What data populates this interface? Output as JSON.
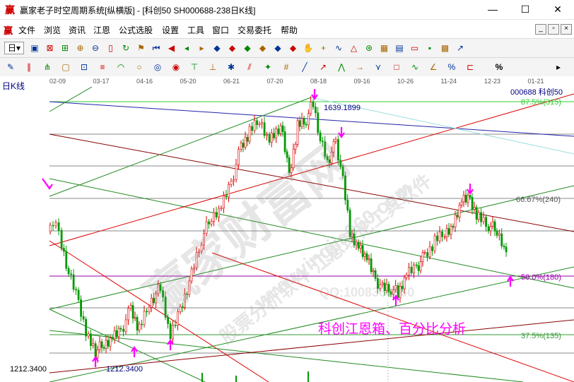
{
  "window": {
    "app_icon": "赢",
    "title": "赢家老子时空周期系统[纵横版] - [科创50   SH000688-238日K线]",
    "minimize": "—",
    "maximize": "☐",
    "close": "✕"
  },
  "menu": {
    "icon": "赢",
    "items": [
      "文件",
      "浏览",
      "资讯",
      "江恩",
      "公式选股",
      "设置",
      "工具",
      "窗口",
      "交易委托",
      "帮助"
    ],
    "mdi_buttons": [
      "_",
      "▫",
      "×"
    ]
  },
  "toolbar1": {
    "period_selector": "日",
    "icons": [
      "select-icon",
      "lock-icon",
      "data-icon",
      "zoom-in-icon",
      "zoom-out-icon",
      "cursor-icon",
      "refresh-icon",
      "flag-icon",
      "first-icon",
      "prev-icon",
      "left-icon",
      "right-icon",
      "diamond-icon",
      "diamond-icon",
      "diamond-icon",
      "diamond-icon",
      "diamond-icon",
      "diamond-icon",
      "hand-icon",
      "crosshair-icon",
      "wave-icon",
      "triangle-icon",
      "gann-icon",
      "calendar-icon",
      "calc-icon",
      "screen-icon",
      "save-icon",
      "print-icon",
      "trend-icon"
    ]
  },
  "toolbar2": {
    "icons": [
      "pen-icon",
      "bars-icon",
      "gann-fan-icon",
      "gann-box-icon",
      "gann-square-icon",
      "fib-icon",
      "arc-icon",
      "circle-icon",
      "cycle-icon",
      "spiral-icon",
      "time-icon",
      "price-icon",
      "compass-icon",
      "channel-icon",
      "star-icon",
      "grid-icon",
      "line-icon",
      "ray-icon",
      "wedge-icon",
      "arrow-icon",
      "zigzag-icon",
      "box-icon",
      "wave-icon",
      "angle-icon",
      "percent-icon",
      "ruler-icon"
    ],
    "percent_label": "%",
    "more_label": "▸"
  },
  "chart": {
    "period_label": "日K线",
    "code_label": "000688  科创50",
    "date_ticks": [
      "02-09",
      "03-17",
      "04-16",
      "05-20",
      "06-21",
      "07-20",
      "08-18",
      "09-16",
      "10-26",
      "11-24",
      "12-23",
      "01-21"
    ],
    "high_label": "1639.1899",
    "low_label": "1212.3400",
    "left_price_label": "1212.3400",
    "levels": [
      {
        "label": "87.5%(315)",
        "color": "#33cc33"
      },
      {
        "label": "66.67%(240)",
        "color": "#555555"
      },
      {
        "label": "50.0%(180)",
        "color": "#9900aa"
      },
      {
        "label": "37.5%(135)",
        "color": "#339933"
      }
    ],
    "annotation": "科创江恩箱、百分比分析",
    "watermark_main": "赢家财富网",
    "watermark_sub": "股票分析软件 江恩理论工具软件",
    "watermark_url": "www.yingjia360.com",
    "watermark_qq": "QQ:1008360360",
    "colors": {
      "up": "#dd0000",
      "down": "#009900",
      "accent": "#ff00ff",
      "price_axis": "#000080"
    }
  }
}
